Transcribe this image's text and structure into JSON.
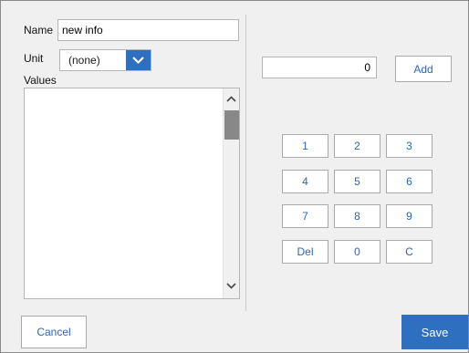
{
  "form": {
    "name_label": "Name",
    "name_value": "new info",
    "unit_label": "Unit",
    "unit_selected": "(none)",
    "values_label": "Values"
  },
  "entry": {
    "value": "0",
    "add_label": "Add"
  },
  "keypad": {
    "keys": [
      "1",
      "2",
      "3",
      "4",
      "5",
      "6",
      "7",
      "8",
      "9",
      "Del",
      "0",
      "C"
    ]
  },
  "footer": {
    "cancel_label": "Cancel",
    "save_label": "Save"
  },
  "colors": {
    "accent": "#2e6fbf",
    "button_text": "#2e67b0",
    "background": "#f0f0f0"
  }
}
